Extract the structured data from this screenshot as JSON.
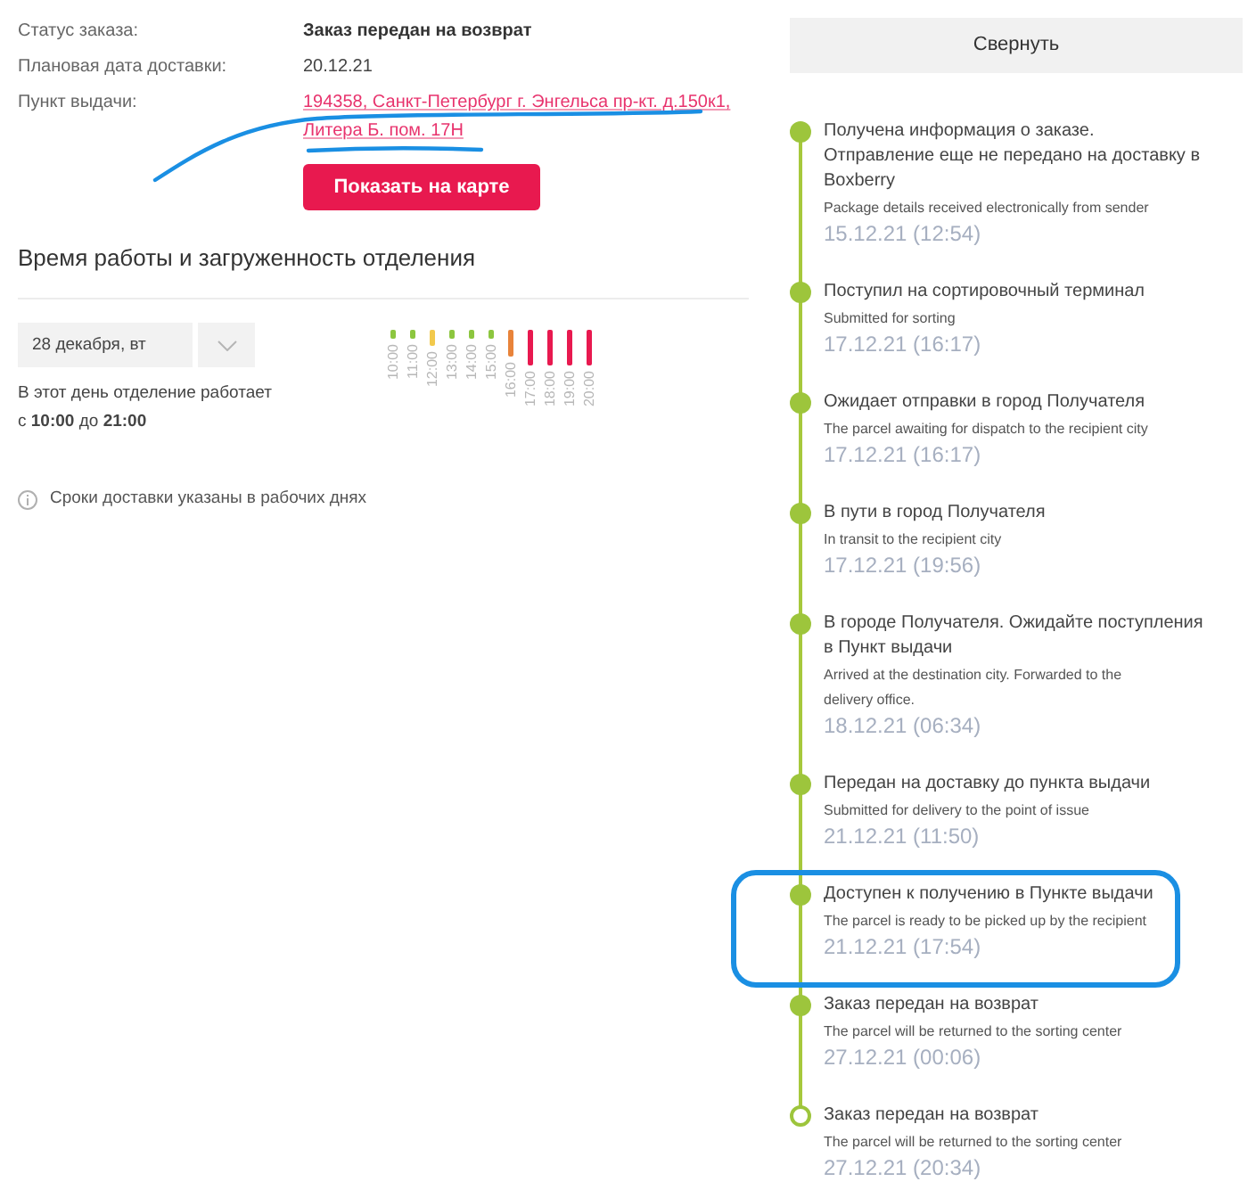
{
  "order_details": [
    {
      "kind": "status",
      "label": "Статус заказа:",
      "value": "Заказ передан на возврат"
    },
    {
      "kind": "date",
      "label": "Плановая дата доставки:",
      "value": "20.12.21"
    },
    {
      "kind": "address",
      "label": "Пункт выдачи:",
      "value": "194358, Санкт-Петербург г. Энгельса пр-кт. д.150к1, Литера Б. пом. 17Н",
      "underlined_by_hand": true
    }
  ],
  "map_button": {
    "label": "Показать на карте"
  },
  "branch_hours": {
    "title": "Время работы и загруженность отделения",
    "day_select": {
      "value": "28 декабря, вт"
    },
    "schedule_text": "В этот день отделение работает\nс **10:00** до **21:00**",
    "load": [
      {
        "label": "10:00",
        "level": 0.25,
        "color": "#8cc63f"
      },
      {
        "label": "11:00",
        "level": 0.25,
        "color": "#8cc63f"
      },
      {
        "label": "12:00",
        "level": 0.45,
        "color": "#f2c94c"
      },
      {
        "label": "13:00",
        "level": 0.25,
        "color": "#8cc63f"
      },
      {
        "label": "14:00",
        "level": 0.25,
        "color": "#8cc63f"
      },
      {
        "label": "15:00",
        "level": 0.25,
        "color": "#8cc63f"
      },
      {
        "label": "16:00",
        "level": 0.75,
        "color": "#e8833a"
      },
      {
        "label": "17:00",
        "level": 1,
        "color": "#e8194f"
      },
      {
        "label": "18:00",
        "level": 1,
        "color": "#e8194f"
      },
      {
        "label": "19:00",
        "level": 1,
        "color": "#e8194f"
      },
      {
        "label": "20:00",
        "level": 1,
        "color": "#e8194f"
      }
    ]
  },
  "note": {
    "text": "Сроки доставки указаны в рабочих днях"
  },
  "collapse_button": {
    "label": "Свернуть"
  },
  "events": [
    {
      "title": "Получена информация о заказе.\nОтправление еще не передано на доставку в Boxberry",
      "subtitle": "Package details received electronically from sender",
      "date": "15.12.21 (12:54)",
      "completed": true,
      "circled_by_hand": false
    },
    {
      "title": "Поступил на сортировочный терминал",
      "subtitle": "Submitted for sorting",
      "date": "17.12.21 (16:17)",
      "completed": true,
      "circled_by_hand": false
    },
    {
      "title": "Ожидает отправки в город Получателя",
      "subtitle": "The parcel awaiting for dispatch to the recipient city",
      "date": "17.12.21 (16:17)",
      "completed": true,
      "circled_by_hand": false
    },
    {
      "title": "В пути в город Получателя",
      "subtitle": "In transit to the recipient city",
      "date": "17.12.21 (19:56)",
      "completed": true,
      "circled_by_hand": false
    },
    {
      "title": "В городе Получателя. Ожидайте поступления в Пункт выдачи",
      "subtitle": "Arrived at the destination city. Forwarded to the delivery office.",
      "date": "18.12.21 (06:34)",
      "completed": true,
      "circled_by_hand": false
    },
    {
      "title": "Передан на доставку до пункта выдачи",
      "subtitle": "Submitted for delivery to the point of issue",
      "date": "21.12.21 (11:50)",
      "completed": true,
      "circled_by_hand": false
    },
    {
      "title": "Доступен к получению в Пункте выдачи",
      "subtitle": "The parcel is ready to be picked up by the recipient",
      "date": "21.12.21 (17:54)",
      "completed": true,
      "circled_by_hand": true
    },
    {
      "title": "Заказ передан на возврат",
      "subtitle": "The parcel will be returned to the sorting center",
      "date": "27.12.21 (00:06)",
      "completed": true,
      "circled_by_hand": false
    },
    {
      "title": "Заказ передан на возврат",
      "subtitle": "The parcel will be returned to the sorting center",
      "date": "27.12.21 (20:34)",
      "completed": false,
      "circled_by_hand": false
    }
  ]
}
